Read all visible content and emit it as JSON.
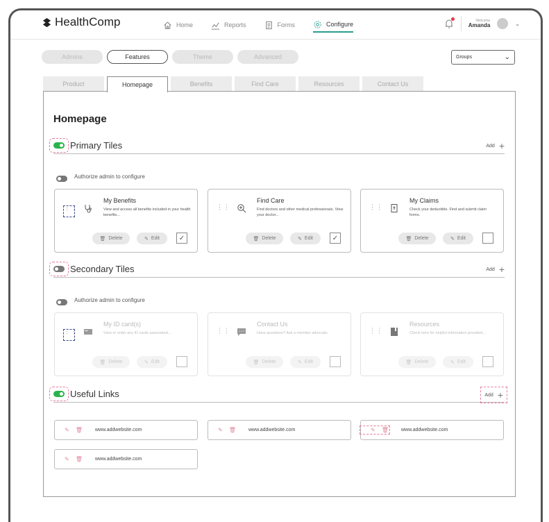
{
  "header": {
    "brand": "HealthComp",
    "nav": [
      {
        "label": "Home",
        "icon": "home-icon"
      },
      {
        "label": "Reports",
        "icon": "chart-icon"
      },
      {
        "label": "Forms",
        "icon": "document-icon"
      },
      {
        "label": "Configure",
        "icon": "gear-icon",
        "active": true
      }
    ],
    "welcome": "Welcome",
    "user_name": "Amanda"
  },
  "config_tabs": [
    {
      "label": "Admins"
    },
    {
      "label": "Features",
      "active": true
    },
    {
      "label": "Theme"
    },
    {
      "label": "Advanced"
    }
  ],
  "groups_select": {
    "value": "Groups"
  },
  "section_tabs": [
    {
      "label": "Product"
    },
    {
      "label": "Homepage",
      "active": true
    },
    {
      "label": "Benefits"
    },
    {
      "label": "Find Care"
    },
    {
      "label": "Resources"
    },
    {
      "label": "Contact Us"
    }
  ],
  "page_title": "Homepage",
  "primary": {
    "label": "Primary Tiles",
    "add": "Add",
    "auth": "Authorize admin to configure",
    "tiles": [
      {
        "title": "My Benefits",
        "desc": "View and access all benefits included in your health benefits...",
        "icon": "stethoscope-icon",
        "checked": "✓"
      },
      {
        "title": "Find Care",
        "desc": "Find doctors and other medical professionals. View your doctor...",
        "icon": "search-plus-icon",
        "checked": "✓"
      },
      {
        "title": "My Claims",
        "desc": "Check your deductible. Find and submit claim forms.",
        "icon": "claim-icon",
        "checked": ""
      }
    ]
  },
  "secondary": {
    "label": "Secondary Tiles",
    "add": "Add",
    "auth": "Authorize admin to configure",
    "tiles": [
      {
        "title": "My ID card(s)",
        "desc": "View or order any ID cards associated...",
        "icon": "id-card-icon"
      },
      {
        "title": "Contact Us",
        "desc": "Have questions? Ask a member advocate.",
        "icon": "chat-icon"
      },
      {
        "title": "Resources",
        "desc": "Check here for helpful information provided...",
        "icon": "book-icon"
      }
    ]
  },
  "tile_buttons": {
    "delete": "Delete",
    "edit": "Edit"
  },
  "useful_links": {
    "label": "Useful Links",
    "add": "Add",
    "links": [
      "www.addwebsite.com",
      "www.addwebsite.com",
      "www.addwebsite.com",
      "www.addwebsite.com"
    ]
  },
  "colors": {
    "accent": "#2a9d8f",
    "toggle_on": "#2bb34a",
    "highlight": "#e77a9b"
  }
}
